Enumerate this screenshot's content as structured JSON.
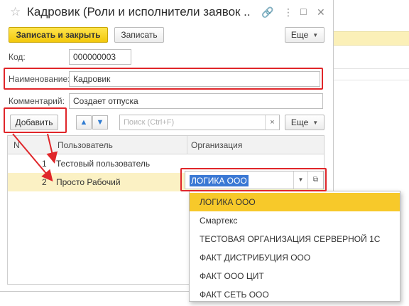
{
  "window": {
    "title": "Кадровик (Роли и исполнители заявок ...",
    "link_icon": "link-icon",
    "more_icon": "vertical-dots-icon",
    "maximize_icon": "maximize-icon",
    "close_icon": "close-icon"
  },
  "toolbar": {
    "save_close_label": "Записать и закрыть",
    "save_label": "Записать",
    "more_label": "Еще"
  },
  "form": {
    "code_label": "Код:",
    "code_value": "000000003",
    "name_label": "Наименование:",
    "name_value": "Кадровик",
    "comment_label": "Комментарий:",
    "comment_value": "Создает отпуска"
  },
  "table_toolbar": {
    "add_label": "Добавить",
    "search_placeholder": "Поиск (Ctrl+F)",
    "clear_symbol": "×",
    "more_label": "Еще"
  },
  "table": {
    "headers": [
      "N",
      "Пользователь",
      "Организация"
    ],
    "rows": [
      {
        "n": "1",
        "user": "Тестовый пользователь",
        "org": ""
      },
      {
        "n": "2",
        "user": "Просто Рабочий",
        "org": "ЛОГИКА ООО"
      }
    ]
  },
  "dropdown": {
    "items": [
      "ЛОГИКА ООО",
      "Смартекс",
      "ТЕСТОВАЯ ОРГАНИЗАЦИЯ СЕРВЕРНОЙ 1С",
      "ФАКТ ДИСТРИБУЦИЯ ООО",
      "ФАКТ ООО ЦИТ",
      "ФАКТ СЕТЬ ООО"
    ],
    "selected": "ЛОГИКА ООО"
  },
  "colors": {
    "primary_button": "#f2c80b",
    "highlight_red": "#e0262a",
    "selected_row": "#fbf1c4",
    "selection_blue": "#3a78d4"
  }
}
